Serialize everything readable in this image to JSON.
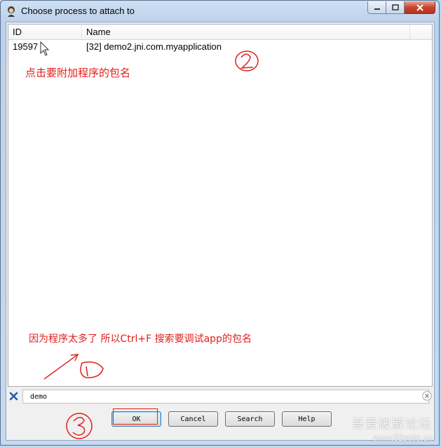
{
  "window": {
    "title": "Choose process to attach to",
    "icon": "app-icon"
  },
  "listview": {
    "columns": [
      "ID",
      "Name"
    ],
    "rows": [
      {
        "id": "19597",
        "name": "[32] demo2.jni.com.myapplication"
      }
    ]
  },
  "annotations": {
    "click_hint": "点击要附加程序的包名",
    "search_hint": "因为程序太多了 所以Ctrl+F 搜索要调试app的包名"
  },
  "filter": {
    "value": "demo"
  },
  "buttons": {
    "ok": "OK",
    "cancel": "Cancel",
    "search": "Search",
    "help": "Help"
  },
  "watermark": {
    "text": "吾爱破解论坛",
    "url": "www.52pojie.cn"
  },
  "colors": {
    "annotation": "#e0201a",
    "titlebar": "#c6d8ee",
    "close_button": "#c7452b"
  }
}
